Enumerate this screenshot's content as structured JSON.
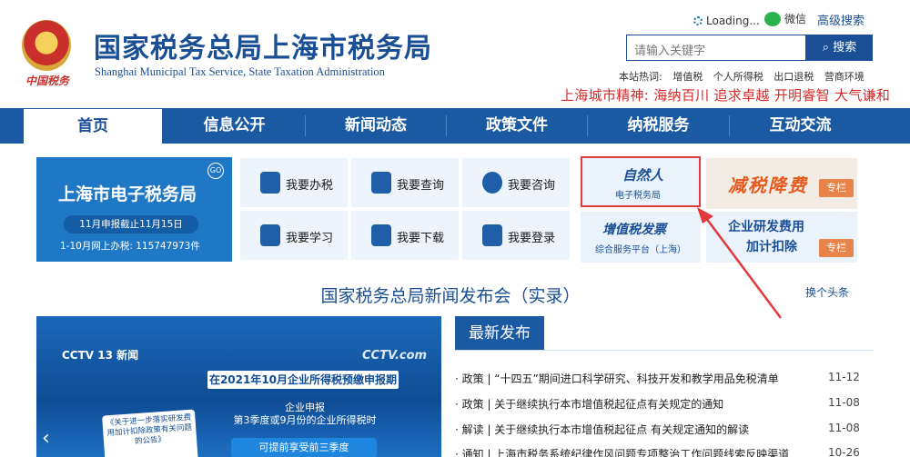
{
  "header": {
    "emblem_text": "中国税务",
    "title": "国家税务总局上海市税务局",
    "subtitle": "Shanghai Municipal Tax Service, State Taxation Administration",
    "loading": "Loading...",
    "wechat": "微信",
    "advanced_search": "高级搜索",
    "search_placeholder": "请输入关键字",
    "search_button": "搜索",
    "hot_label": "本站热词:",
    "hot_words": [
      "增值税",
      "个人所得税",
      "出口退税",
      "营商环境"
    ],
    "spirit": "上海城市精神:  海纳百川 追求卓越 开明睿智 大气谦和"
  },
  "nav": {
    "items": [
      "首页",
      "信息公开",
      "新闻动态",
      "政策文件",
      "纳税服务",
      "互动交流"
    ]
  },
  "etax": {
    "title": "上海市电子税务局",
    "go": "GO",
    "deadline": "11月申报截止11月15日",
    "count_line": "1-10月网上办税:  115747973件"
  },
  "services": [
    "我要办税",
    "我要查询",
    "我要咨询",
    "我要学习",
    "我要下载",
    "我要登录"
  ],
  "promos": {
    "natural_person_title": "自然人",
    "natural_person_sub": "电子税务局",
    "tax_cut": "减税降费",
    "tax_cut_tag": "专栏",
    "vat_title": "增值税发票",
    "vat_sub": "综合服务平台（上海）",
    "rd_line1": "企业研发费用",
    "rd_line2": "加计扣除",
    "rd_tag": "专栏"
  },
  "headline": {
    "title": "国家税务总局新闻发布会（实录）",
    "swap": "换个头条"
  },
  "video": {
    "cctv_left": "CCTV 13 新闻",
    "cctv_right": "CCTV.com",
    "banner": "在2021年10月企业所得税预缴申报期",
    "line1": "企业申报",
    "line2": "第3季度或9月份的企业所得税时",
    "doc_text": "《关于进一步落实研发费用加计扣除政策有关问题的公告》",
    "pill": "可提前享受前三季度"
  },
  "latest": {
    "tab": "最新发布",
    "items": [
      {
        "title": "· 政策 | “十四五”期间进口科学研究、科技开发和教学用品免税清单",
        "date": "11-12"
      },
      {
        "title": "· 政策 | 关于继续执行本市增值税起征点有关规定的通知",
        "date": "11-08"
      },
      {
        "title": "· 解读 | 关于继续执行本市增值税起征点 有关规定通知的解读",
        "date": "11-08"
      },
      {
        "title": "· 通知 | 上海市税务系统纪律作风问题专项整治工作问题线索反映渠道",
        "date": "10-26"
      }
    ]
  },
  "colors": {
    "brand_blue": "#1a5aa2",
    "accent_red": "#e03a3a"
  }
}
